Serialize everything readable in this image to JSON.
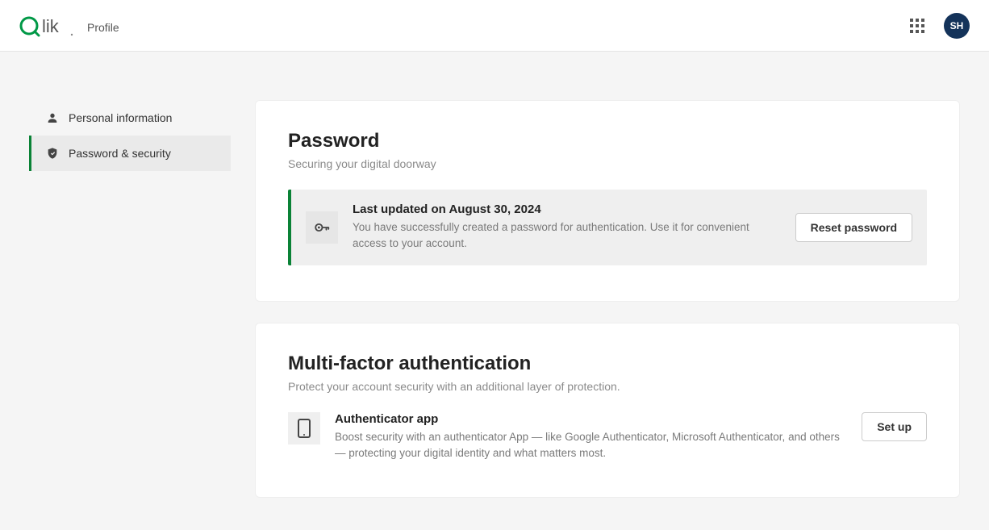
{
  "header": {
    "page_label": "Profile",
    "avatar_initials": "SH"
  },
  "sidebar": {
    "items": [
      {
        "label": "Personal information",
        "active": false
      },
      {
        "label": "Password & security",
        "active": true
      }
    ]
  },
  "password_card": {
    "title": "Password",
    "subtitle": "Securing your digital doorway",
    "notice_title": "Last updated on August 30, 2024",
    "notice_desc": "You have successfully created a password for authentication. Use it for convenient access to your account.",
    "reset_label": "Reset password"
  },
  "mfa_card": {
    "title": "Multi-factor authentication",
    "subtitle": "Protect your account security with an additional layer of protection.",
    "item_title": "Authenticator app",
    "item_desc": "Boost security with an authenticator App — like Google Authenticator, Microsoft Authenticator, and others — protecting your digital identity and what matters most.",
    "setup_label": "Set up"
  }
}
